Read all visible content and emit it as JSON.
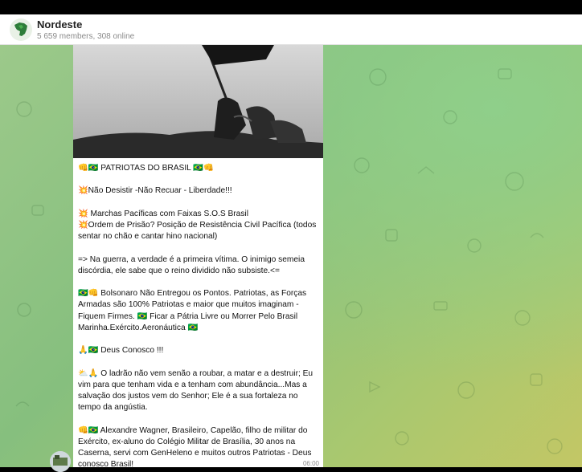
{
  "header": {
    "title": "Nordeste",
    "subtitle": "5 659 members, 308 online"
  },
  "message": {
    "time": "06:00",
    "paragraphs": [
      "👊🇧🇷 PATRIOTAS DO BRASIL 🇧🇷👊",
      "💥Não Desistir -Não Recuar - Liberdade!!!",
      "💥 Marchas Pacíficas com Faixas S.O.S Brasil\n💥Ordem de Prisão? Posição de Resistência Civil Pacífica (todos sentar no chão e cantar hino nacional)",
      "=> Na guerra, a verdade é a primeira vítima. O inimigo semeia discórdia, ele sabe que o reino dividido não subsiste.<=",
      "🇧🇷👊 Bolsonaro Não Entregou os Pontos. Patriotas, as Forças Armadas são 100% Patriotas e maior que muitos imaginam - Fiquem Firmes. 🇧🇷 Ficar a Pátria Livre ou Morrer Pelo Brasil Marinha.Exército.Aeronáutica 🇧🇷",
      "🙏🇧🇷 Deus Conosco !!!",
      "⛅🙏 O ladrão não vem senão a roubar, a matar e a destruir; Eu vim para que tenham vida e a tenham com abundância...Mas a salvação dos justos vem do Senhor; Ele é a sua fortaleza no tempo da angústia.",
      "👊🇧🇷 Alexandre Wagner, Brasileiro, Capelão, filho de militar do Exército, ex-aluno do Colégio Militar de Brasília, 30 anos na Caserna, servi com GenHeleno e muitos outros Patriotas - Deus conosco Brasil!"
    ]
  },
  "colors": {
    "header_bg": "#ffffff",
    "chat_bg": "#8fc582",
    "bubble_bg": "#ffffff",
    "flag_green": "#1a9a3c",
    "flag_yellow": "#f2d21b"
  }
}
